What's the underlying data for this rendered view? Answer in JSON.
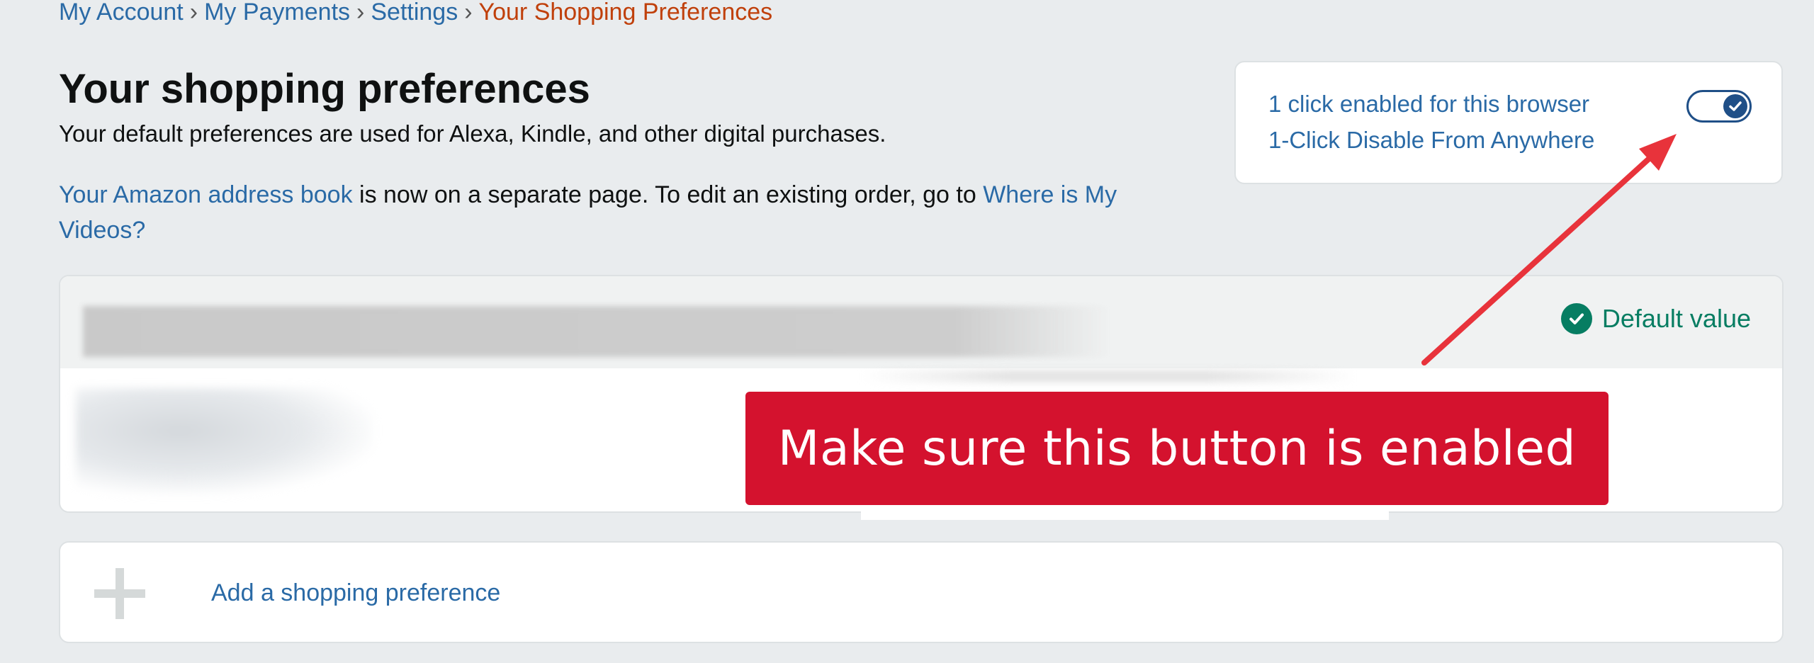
{
  "breadcrumb": {
    "items": [
      "My Account",
      "My Payments",
      "Settings"
    ],
    "separator": "›",
    "current": "Your Shopping Preferences"
  },
  "page": {
    "title": "Your shopping preferences",
    "subtitle": "Your default preferences are used for Alexa, Kindle, and other digital purchases.",
    "info_link1": "Your Amazon address book",
    "info_text": " is now on a separate page. To edit an existing order, go to ",
    "info_link2": "Where is My Videos?"
  },
  "oneclick": {
    "status": "1 click enabled for this browser",
    "disable_link": "1-Click Disable From Anywhere",
    "toggle_on": true
  },
  "preference_card": {
    "badge": "Default value",
    "badge_icon": "check-circle-icon"
  },
  "callout": {
    "text": "Make sure this button is enabled"
  },
  "add_preference": {
    "label": "Add a shopping preference",
    "icon": "plus-icon"
  },
  "colors": {
    "link": "#2a6aa6",
    "breadcrumb_current": "#c0400b",
    "success": "#067d62",
    "toggle": "#1f4f87",
    "callout_bg": "#d4122e",
    "arrow": "#e8333b"
  }
}
